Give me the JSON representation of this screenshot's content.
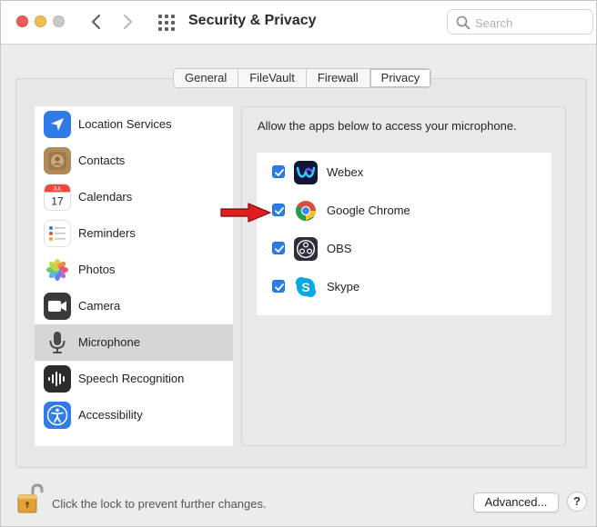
{
  "window": {
    "title": "Security & Privacy"
  },
  "search": {
    "placeholder": "Search",
    "value": ""
  },
  "tabs": [
    {
      "label": "General",
      "active": false
    },
    {
      "label": "FileVault",
      "active": false
    },
    {
      "label": "Firewall",
      "active": false
    },
    {
      "label": "Privacy",
      "active": true
    }
  ],
  "sidebar": {
    "selected": "Microphone",
    "items": [
      {
        "label": "Location Services",
        "icon": "location-arrow-icon"
      },
      {
        "label": "Contacts",
        "icon": "contacts-book-icon"
      },
      {
        "label": "Calendars",
        "icon": "calendar-icon",
        "icon_month": "JUL",
        "icon_day": "17"
      },
      {
        "label": "Reminders",
        "icon": "reminders-list-icon"
      },
      {
        "label": "Photos",
        "icon": "photos-flower-icon"
      },
      {
        "label": "Camera",
        "icon": "camera-icon"
      },
      {
        "label": "Microphone",
        "icon": "microphone-icon"
      },
      {
        "label": "Speech Recognition",
        "icon": "speech-waveform-icon"
      },
      {
        "label": "Accessibility",
        "icon": "accessibility-person-icon"
      }
    ]
  },
  "panel": {
    "description": "Allow the apps below to access your microphone.",
    "apps": [
      {
        "name": "Webex",
        "checked": true,
        "icon": "webex-icon"
      },
      {
        "name": "Google Chrome",
        "checked": true,
        "icon": "chrome-icon"
      },
      {
        "name": "OBS",
        "checked": true,
        "icon": "obs-icon"
      },
      {
        "name": "Skype",
        "checked": true,
        "icon": "skype-icon"
      }
    ]
  },
  "footer": {
    "lock_text": "Click the lock to prevent further changes.",
    "advanced_label": "Advanced...",
    "help_label": "?"
  },
  "colors": {
    "checkbox": "#2b7de9",
    "annotation_arrow": "#e01e1e",
    "selected_row": "#d6d6d6"
  }
}
